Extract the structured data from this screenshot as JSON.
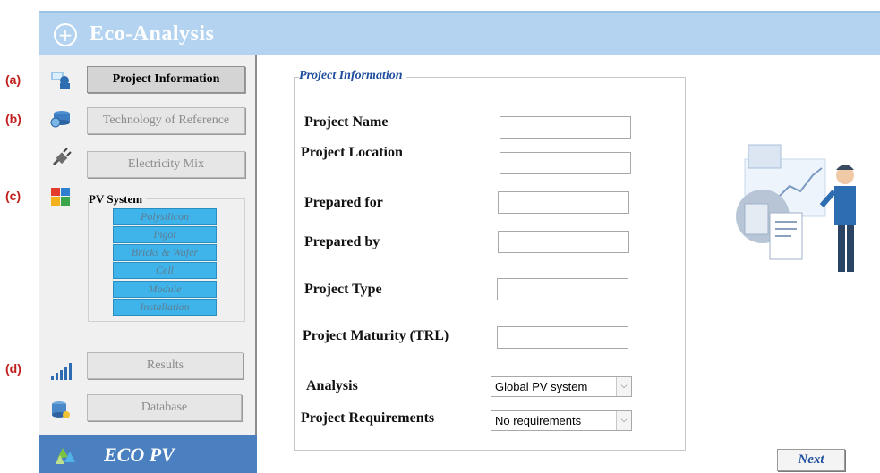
{
  "window": {
    "title": "Eco-Analysis"
  },
  "annotations": [
    "(a)",
    "(b)",
    "(c)",
    "(d)"
  ],
  "sidebar": {
    "items": [
      {
        "label": "Project Information",
        "icon": "project-icon",
        "active": true
      },
      {
        "label": "Technology of Reference",
        "icon": "database-icon",
        "active": false
      },
      {
        "label": "Electricity Mix",
        "icon": "plug-icon",
        "active": false
      },
      {
        "label": "Results",
        "icon": "bar-chart-icon",
        "active": false
      },
      {
        "label": "Database",
        "icon": "database-stack-icon",
        "active": false
      }
    ],
    "pv_system": {
      "label": "PV System",
      "icon": "puzzle-icon",
      "steps": [
        "Polysilicon",
        "Ingot",
        "Bricks & Wafer",
        "Cell",
        "Module",
        "Installation"
      ]
    }
  },
  "brand": {
    "name": "ECO PV",
    "icon": "recycle-icon"
  },
  "form": {
    "legend": "Project Information",
    "fields": [
      {
        "label": "Project Name",
        "value": ""
      },
      {
        "label": "Project Location",
        "value": ""
      },
      {
        "label": "Prepared for",
        "value": ""
      },
      {
        "label": "Prepared by",
        "value": ""
      },
      {
        "label": "Project Type",
        "value": ""
      },
      {
        "label": "Project Maturity (TRL)",
        "value": ""
      }
    ],
    "analysis": {
      "label": "Analysis",
      "selected": "Global PV system"
    },
    "requirements": {
      "label": "Project Requirements",
      "selected": "No requirements"
    }
  },
  "next_label": "Next",
  "colors": {
    "title_bar": "#b4d3f0",
    "brand": "#4a7fc0",
    "pv_step": "#3fb4ea",
    "annotation": "#c0201e",
    "legend": "#1f4e9c"
  }
}
